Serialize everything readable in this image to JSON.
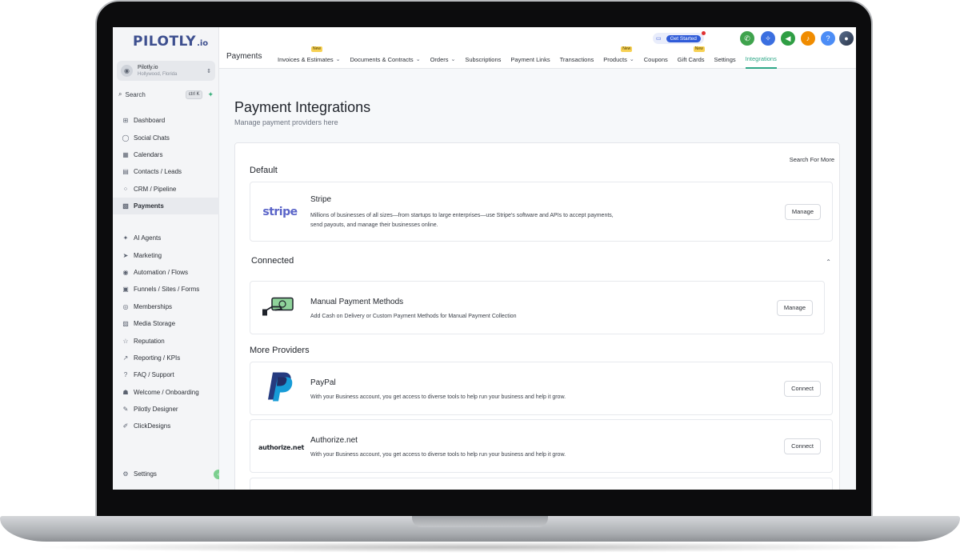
{
  "brand": {
    "logo_main": "PILOTLY",
    "logo_sub": ".io"
  },
  "account": {
    "name": "Pilotly.io",
    "location": "Hollywood, Florida"
  },
  "search": {
    "label": "Search",
    "shortcut": "ctrl K"
  },
  "sidebar": {
    "group1": [
      {
        "label": "Dashboard",
        "icon": "dashboard-icon",
        "glyph": "⊞"
      },
      {
        "label": "Social Chats",
        "icon": "chat-icon",
        "glyph": "◯"
      },
      {
        "label": "Calendars",
        "icon": "calendar-icon",
        "glyph": "▦"
      },
      {
        "label": "Contacts / Leads",
        "icon": "contacts-icon",
        "glyph": "▤"
      },
      {
        "label": "CRM / Pipeline",
        "icon": "pipeline-icon",
        "glyph": "⁘"
      },
      {
        "label": "Payments",
        "icon": "payments-icon",
        "glyph": "▧",
        "active": true
      }
    ],
    "group2": [
      {
        "label": "AI Agents",
        "icon": "sparkle-icon",
        "glyph": "✦"
      },
      {
        "label": "Marketing",
        "icon": "send-icon",
        "glyph": "➤"
      },
      {
        "label": "Automation / Flows",
        "icon": "automation-icon",
        "glyph": "◉"
      },
      {
        "label": "Funnels / Sites / Forms",
        "icon": "funnel-icon",
        "glyph": "▣"
      },
      {
        "label": "Memberships",
        "icon": "membership-icon",
        "glyph": "◎"
      },
      {
        "label": "Media Storage",
        "icon": "media-icon",
        "glyph": "▨"
      },
      {
        "label": "Reputation",
        "icon": "star-icon",
        "glyph": "☆"
      },
      {
        "label": "Reporting / KPIs",
        "icon": "trend-icon",
        "glyph": "↗"
      },
      {
        "label": "FAQ / Support",
        "icon": "question-icon",
        "glyph": "?"
      },
      {
        "label": "Welcome / Onboarding",
        "icon": "users-icon",
        "glyph": "☗"
      },
      {
        "label": "Pilotly Designer",
        "icon": "brush-icon",
        "glyph": "✎"
      },
      {
        "label": "ClickDesigns",
        "icon": "wrench-icon",
        "glyph": "✐"
      }
    ],
    "settings_label": "Settings"
  },
  "topbar": {
    "get_started": "Get Started",
    "section_title": "Payments",
    "tabs": [
      {
        "label": "Invoices & Estimates",
        "chevron": true,
        "new": true
      },
      {
        "label": "Documents & Contracts",
        "chevron": true,
        "new": false
      },
      {
        "label": "Orders",
        "chevron": true,
        "new": false
      },
      {
        "label": "Subscriptions",
        "chevron": false,
        "new": false
      },
      {
        "label": "Payment Links",
        "chevron": false,
        "new": false
      },
      {
        "label": "Transactions",
        "chevron": false,
        "new": false
      },
      {
        "label": "Products",
        "chevron": true,
        "new": true
      },
      {
        "label": "Coupons",
        "chevron": false,
        "new": false
      },
      {
        "label": "Gift Cards",
        "chevron": false,
        "new": true
      },
      {
        "label": "Settings",
        "chevron": false,
        "new": false
      },
      {
        "label": "Integrations",
        "chevron": false,
        "new": false,
        "active": true
      }
    ],
    "new_badge": "New",
    "colors": {
      "phone": "#3fa34d",
      "magic": "#3b6fe0",
      "megaphone": "#2f9e44",
      "bell": "#f08c00",
      "help": "#4c8df6"
    }
  },
  "main": {
    "title": "Payment Integrations",
    "subtitle": "Manage payment providers here",
    "search_more": "Search For More",
    "default_label": "Default",
    "connected_label": "Connected",
    "more_label": "More Providers",
    "default_provider": {
      "name": "Stripe",
      "logo_text": "stripe",
      "desc_line1": "Millions of businesses of all sizes—from startups to large enterprises—use Stripe's software and APIs to accept payments,",
      "desc_line2": "send payouts, and manage their businesses online.",
      "button": "Manage"
    },
    "connected_provider": {
      "name": "Manual Payment Methods",
      "desc": "Add Cash on Delivery or Custom Payment Methods for Manual Payment Collection",
      "button": "Manage"
    },
    "more_providers": [
      {
        "name": "PayPal",
        "desc": "With your Business account, you get access to diverse tools to help run your business and help it grow.",
        "button": "Connect"
      },
      {
        "name": "Authorize.net",
        "logo_text": "authorize.net",
        "desc": "With your Business account, you get access to diverse tools to help run your business and help it grow.",
        "button": "Connect"
      }
    ]
  }
}
